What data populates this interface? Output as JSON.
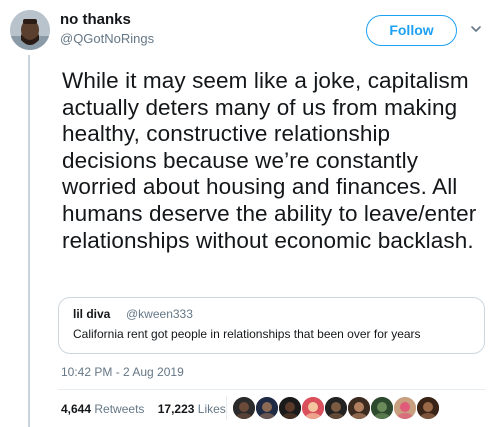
{
  "author": {
    "name": "no thanks",
    "handle": "@QGotNoRings",
    "avatar_color": "#b9c3cc"
  },
  "follow_button": {
    "label": "Follow",
    "color": "#1da1f2"
  },
  "menu": {
    "icon": "chevron-down-icon"
  },
  "tweet": {
    "text": "While it may seem like a joke, capitalism actually deters many of us from making healthy, constructive relationship decisions because we’re constantly worried about housing and finances. All humans deserve the ability to leave/enter relationships without economic backlash."
  },
  "quoted_tweet": {
    "name": "lil diva",
    "handle": "@kween333",
    "text": "California rent got people in relationships that been over for years"
  },
  "timestamp": "10:42 PM - 2 Aug 2019",
  "stats": {
    "retweets": {
      "count": "4,644",
      "label": "Retweets"
    },
    "likes": {
      "count": "17,223",
      "label": "Likes"
    }
  },
  "liker_avatars": [
    {
      "color": "#2b2b2b",
      "accent": "#6b4a3a"
    },
    {
      "color": "#1f2a44",
      "accent": "#8a6a55"
    },
    {
      "color": "#1a1a1a",
      "accent": "#5a3a2a"
    },
    {
      "color": "#d94f5c",
      "accent": "#f3c6a0"
    },
    {
      "color": "#222222",
      "accent": "#7a5a40"
    },
    {
      "color": "#3b2a20",
      "accent": "#b08060"
    },
    {
      "color": "#2e4a2e",
      "accent": "#6a8a5a"
    },
    {
      "color": "#c8a080",
      "accent": "#e05a7a"
    },
    {
      "color": "#3a2418",
      "accent": "#9a6a48"
    }
  ]
}
